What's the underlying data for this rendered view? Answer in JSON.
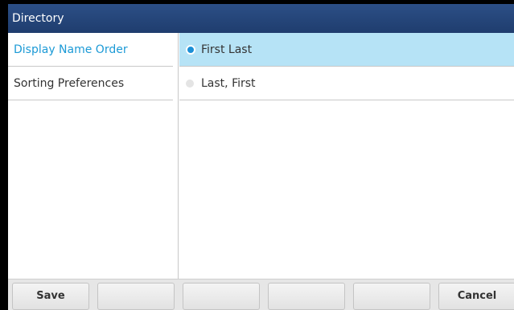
{
  "titlebar": {
    "title": "Directory"
  },
  "sidebar": {
    "items": [
      {
        "label": "Display Name Order",
        "active": true
      },
      {
        "label": "Sorting Preferences",
        "active": false
      }
    ]
  },
  "options": [
    {
      "label": "First Last",
      "selected": true
    },
    {
      "label": "Last, First",
      "selected": false
    }
  ],
  "softkeys": {
    "save_label": "Save",
    "cancel_label": "Cancel"
  },
  "colors": {
    "titlebar": "#2c4f86",
    "accent": "#1c9ad6",
    "selected_row": "#b6e3f6"
  }
}
